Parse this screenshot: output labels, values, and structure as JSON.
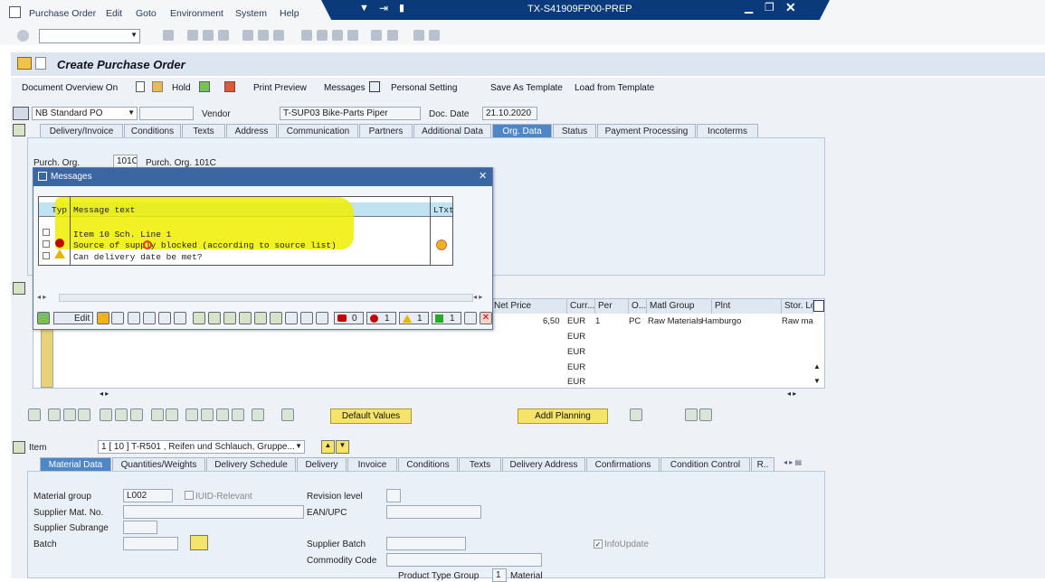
{
  "window": {
    "system_title": "TX-S41909FP00-PREP"
  },
  "menu": [
    "Purchase Order",
    "Edit",
    "Goto",
    "Environment",
    "System",
    "Help"
  ],
  "app": {
    "title": "Create Purchase Order"
  },
  "app_toolbar": {
    "doc_overview": "Document Overview On",
    "hold": "Hold",
    "print_preview": "Print Preview",
    "messages": "Messages",
    "personal_setting": "Personal Setting",
    "save_template": "Save As Template",
    "load_template": "Load from Template"
  },
  "header": {
    "po_type": "NB Standard PO",
    "vendor_label": "Vendor",
    "vendor_value": "T-SUP03 Bike-Parts Piper",
    "doc_date_label": "Doc. Date",
    "doc_date_value": "21.10.2020"
  },
  "header_tabs": [
    "Delivery/Invoice",
    "Conditions",
    "Texts",
    "Address",
    "Communication",
    "Partners",
    "Additional Data",
    "Org. Data",
    "Status",
    "Payment Processing",
    "Incoterms"
  ],
  "org_data": {
    "purch_org_label": "Purch. Org.",
    "purch_org_value": "101C",
    "purch_org_desc": "Purch. Org. 101C"
  },
  "messages_dialog": {
    "title": "Messages",
    "col_typ": "Typ",
    "col_text": "Message text",
    "col_ltxt": "LTxt",
    "rows": [
      "Item 10 Sch. Line 1",
      "Source of supply blocked (according to source list)",
      "Can delivery date be met?"
    ],
    "toolbar": {
      "edit": "Edit",
      "count_stop": "0",
      "count_error": "1",
      "count_warning": "1",
      "count_success": "1"
    }
  },
  "items_grid": {
    "headers": [
      "Net Price",
      "Curr...",
      "Per",
      "O...",
      "Matl Group",
      "Plnt",
      "Stor. Lo"
    ],
    "row1": {
      "net_price": "6,50",
      "curr": "EUR",
      "per": "1",
      "oun": "PC",
      "matl_group": "Raw Materials",
      "plant": "Hamburgo",
      "stor": "Raw ma"
    },
    "curr_rows": [
      "EUR",
      "EUR",
      "EUR",
      "EUR"
    ]
  },
  "grid_buttons": {
    "default_values": "Default Values",
    "addl_planning": "Addl Planning"
  },
  "item_section": {
    "label": "Item",
    "selector": "1 [ 10 ] T-R501 , Reifen und Schlauch, Gruppe..."
  },
  "item_tabs": [
    "Material Data",
    "Quantities/Weights",
    "Delivery Schedule",
    "Delivery",
    "Invoice",
    "Conditions",
    "Texts",
    "Delivery Address",
    "Confirmations",
    "Condition Control",
    "R.."
  ],
  "material_data": {
    "material_group_label": "Material group",
    "material_group_value": "L002",
    "iuid_label": "IUID-Relevant",
    "revision_label": "Revision level",
    "supplier_mat_label": "Supplier Mat. No.",
    "ean_label": "EAN/UPC",
    "supplier_subrange_label": "Supplier Subrange",
    "batch_label": "Batch",
    "supplier_batch_label": "Supplier Batch",
    "info_update_label": "InfoUpdate",
    "commodity_label": "Commodity Code",
    "product_type_label": "Product Type Group",
    "product_type_value": "1",
    "product_type_desc": "Material"
  }
}
